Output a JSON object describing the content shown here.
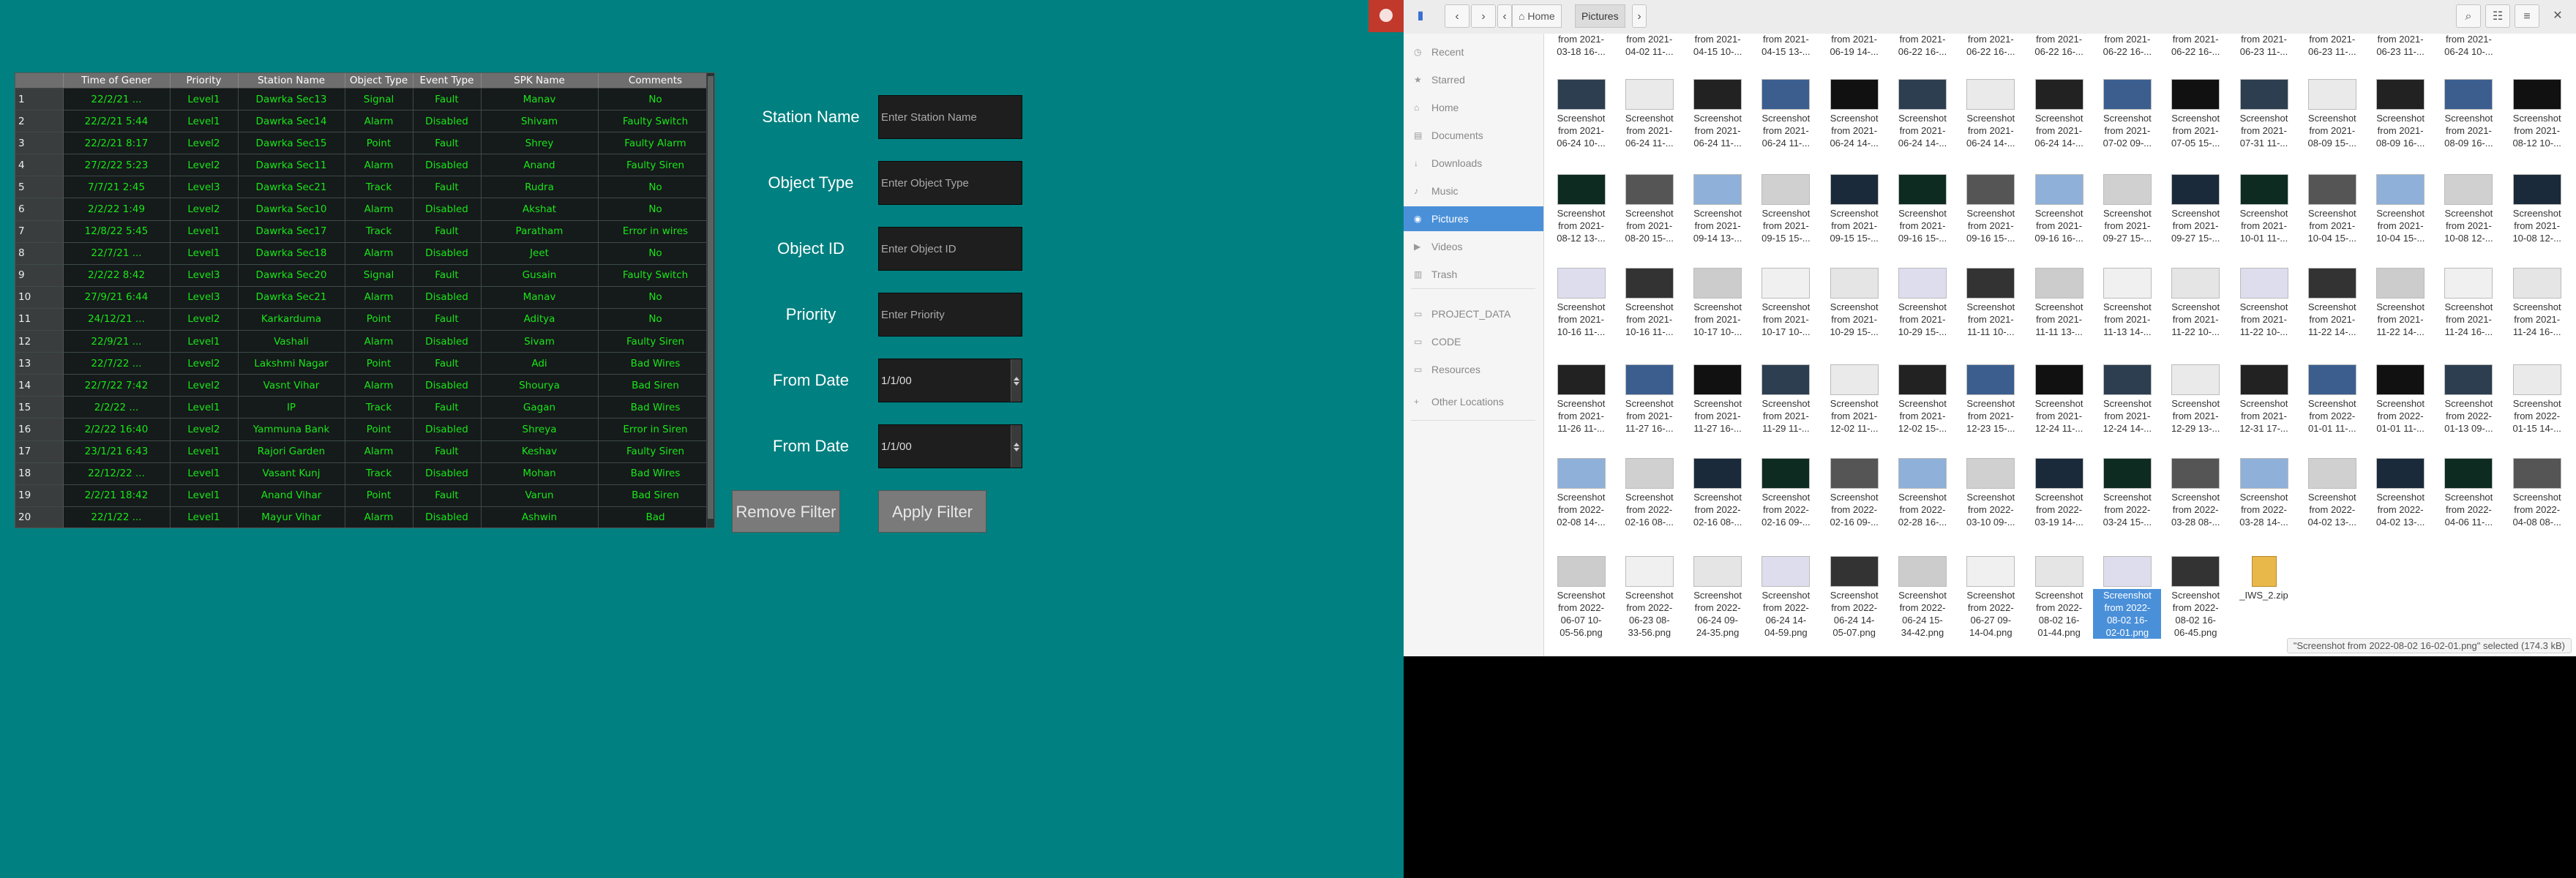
{
  "table": {
    "headers": [
      "Time of Gener",
      "Priority",
      "Station Name",
      "Object Type",
      "Event Type",
      "SPK Name",
      "Comments"
    ],
    "rows": [
      [
        "1",
        "22/2/21 ...",
        "Level1",
        "Dawrka Sec13",
        "Signal",
        "Fault",
        "Manav",
        "No"
      ],
      [
        "2",
        "22/2/21 5:44",
        "Level1",
        "Dawrka Sec14",
        "Alarm",
        "Disabled",
        "Shivam",
        "Faulty Switch"
      ],
      [
        "3",
        "22/2/21 8:17",
        "Level2",
        "Dawrka Sec15",
        "Point",
        "Fault",
        "Shrey",
        "Faulty Alarm"
      ],
      [
        "4",
        "27/2/22 5:23",
        "Level2",
        "Dawrka Sec11",
        "Alarm",
        "Disabled",
        "Anand",
        "Faulty Siren"
      ],
      [
        "5",
        "7/7/21 2:45",
        "Level3",
        "Dawrka Sec21",
        "Track",
        "Fault",
        "Rudra",
        "No"
      ],
      [
        "6",
        "2/2/22 1:49",
        "Level2",
        "Dawrka Sec10",
        "Alarm",
        "Disabled",
        "Akshat",
        "No"
      ],
      [
        "7",
        "12/8/22 5:45",
        "Level1",
        "Dawrka Sec17",
        "Track",
        "Fault",
        "Paratham",
        "Error in wires"
      ],
      [
        "8",
        "22/7/21 ...",
        "Level1",
        "Dawrka Sec18",
        "Alarm",
        "Disabled",
        "Jeet",
        "No"
      ],
      [
        "9",
        "2/2/22 8:42",
        "Level3",
        "Dawrka Sec20",
        "Signal",
        "Fault",
        "Gusain",
        "Faulty Switch"
      ],
      [
        "10",
        "27/9/21 6:44",
        "Level3",
        "Dawrka Sec21",
        "Alarm",
        "Disabled",
        "Manav",
        "No"
      ],
      [
        "11",
        "24/12/21 ...",
        "Level2",
        "Karkarduma",
        "Point",
        "Fault",
        "Aditya",
        "No"
      ],
      [
        "12",
        "22/9/21 ...",
        "Level1",
        "Vashali",
        "Alarm",
        "Disabled",
        "Sivam",
        "Faulty Siren"
      ],
      [
        "13",
        "22/7/22 ...",
        "Level2",
        "Lakshmi Nagar",
        "Point",
        "Fault",
        "Adi",
        "Bad Wires"
      ],
      [
        "14",
        "22/7/22 7:42",
        "Level2",
        "Vasnt Vihar",
        "Alarm",
        "Disabled",
        "Shourya",
        "Bad Siren"
      ],
      [
        "15",
        "2/2/22 ...",
        "Level1",
        "IP",
        "Track",
        "Fault",
        "Gagan",
        "Bad Wires"
      ],
      [
        "16",
        "2/2/22 16:40",
        "Level2",
        "Yammuna Bank",
        "Point",
        "Disabled",
        "Shreya",
        "Error in Siren"
      ],
      [
        "17",
        "23/1/21 6:43",
        "Level1",
        "Rajori Garden",
        "Alarm",
        "Fault",
        "Keshav",
        "Faulty Siren"
      ],
      [
        "18",
        "22/12/22 ...",
        "Level1",
        "Vasant Kunj",
        "Track",
        "Disabled",
        "Mohan",
        "Bad Wires"
      ],
      [
        "19",
        "2/2/21 18:42",
        "Level1",
        "Anand Vihar",
        "Point",
        "Fault",
        "Varun",
        "Bad Siren"
      ],
      [
        "20",
        "22/1/22 ...",
        "Level1",
        "Mayur Vihar",
        "Alarm",
        "Disabled",
        "Ashwin",
        "Bad"
      ]
    ]
  },
  "filters": {
    "station_name_label": "Station Name",
    "station_name_placeholder": "Enter Station Name",
    "object_type_label": "Object Type",
    "object_type_placeholder": "Enter Object Type",
    "object_id_label": "Object ID",
    "object_id_placeholder": "Enter Object ID",
    "priority_label": "Priority",
    "priority_placeholder": "Enter Priority",
    "from_date_label": "From Date",
    "from_date_value": "1/1/00",
    "from_date2_label": "From Date",
    "from_date2_value": "1/1/00",
    "remove_filter": "Remove Filter",
    "apply_filter": "Apply Filter"
  },
  "file_manager": {
    "path": [
      "Home",
      "Pictures"
    ],
    "sidebar": [
      "Recent",
      "Starred",
      "Home",
      "Documents",
      "Downloads",
      "Music",
      "Pictures",
      "Videos",
      "Trash",
      "PROJECT_DATA",
      "CODE",
      "Resources",
      "Other Locations"
    ],
    "sidebar_icons": [
      "clock-icon",
      "star-icon",
      "home-icon",
      "document-icon",
      "download-icon",
      "music-icon",
      "camera-icon",
      "video-icon",
      "trash-icon",
      "folder-icon",
      "folder-icon",
      "folder-icon",
      "plus-icon"
    ],
    "status": "\"Screenshot from 2022-08-02 16-02-01.png\" selected (174.3 kB)",
    "top_row": [
      "from 2021-\n03-18 16-...",
      "from 2021-\n04-02 11-...",
      "from 2021-\n04-15 10-...",
      "from 2021-\n04-15 13-...",
      "from 2021-\n06-19 14-...",
      "from 2021-\n06-22 16-...",
      "from 2021-\n06-22 16-...",
      "from 2021-\n06-22 16-...",
      "from 2021-\n06-22 16-...",
      "from 2021-\n06-22 16-...",
      "from 2021-\n06-23 11-...",
      "from 2021-\n06-23 11-...",
      "from 2021-\n06-23 11-...",
      "from 2021-\n06-24 10-..."
    ],
    "rows": [
      [
        "Screenshot\nfrom 2021-\n06-24 10-...",
        "Screenshot\nfrom 2021-\n06-24 11-...",
        "Screenshot\nfrom 2021-\n06-24 11-...",
        "Screenshot\nfrom 2021-\n06-24 11-...",
        "Screenshot\nfrom 2021-\n06-24 14-...",
        "Screenshot\nfrom 2021-\n06-24 14-...",
        "Screenshot\nfrom 2021-\n06-24 14-...",
        "Screenshot\nfrom 2021-\n06-24 14-...",
        "Screenshot\nfrom 2021-\n07-02 09-...",
        "Screenshot\nfrom 2021-\n07-05 15-...",
        "Screenshot\nfrom 2021-\n07-31 11-...",
        "Screenshot\nfrom 2021-\n08-09 15-...",
        "Screenshot\nfrom 2021-\n08-09 16-...",
        "Screenshot\nfrom 2021-\n08-09 16-...",
        "Screenshot\nfrom 2021-\n08-12 10-..."
      ],
      [
        "Screenshot\nfrom 2021-\n08-12 13-...",
        "Screenshot\nfrom 2021-\n08-20 15-...",
        "Screenshot\nfrom 2021-\n09-14 13-...",
        "Screenshot\nfrom 2021-\n09-15 15-...",
        "Screenshot\nfrom 2021-\n09-15 15-...",
        "Screenshot\nfrom 2021-\n09-16 15-...",
        "Screenshot\nfrom 2021-\n09-16 15-...",
        "Screenshot\nfrom 2021-\n09-16 16-...",
        "Screenshot\nfrom 2021-\n09-27 15-...",
        "Screenshot\nfrom 2021-\n09-27 15-...",
        "Screenshot\nfrom 2021-\n10-01 11-...",
        "Screenshot\nfrom 2021-\n10-04 15-...",
        "Screenshot\nfrom 2021-\n10-04 15-...",
        "Screenshot\nfrom 2021-\n10-08 12-...",
        "Screenshot\nfrom 2021-\n10-08 12-..."
      ],
      [
        "Screenshot\nfrom 2021-\n10-16 11-...",
        "Screenshot\nfrom 2021-\n10-16 11-...",
        "Screenshot\nfrom 2021-\n10-17 10-...",
        "Screenshot\nfrom 2021-\n10-17 10-...",
        "Screenshot\nfrom 2021-\n10-29 15-...",
        "Screenshot\nfrom 2021-\n10-29 15-...",
        "Screenshot\nfrom 2021-\n11-11 10-...",
        "Screenshot\nfrom 2021-\n11-11 13-...",
        "Screenshot\nfrom 2021-\n11-13 14-...",
        "Screenshot\nfrom 2021-\n11-22 10-...",
        "Screenshot\nfrom 2021-\n11-22 10-...",
        "Screenshot\nfrom 2021-\n11-22 14-...",
        "Screenshot\nfrom 2021-\n11-22 14-...",
        "Screenshot\nfrom 2021-\n11-24 16-...",
        "Screenshot\nfrom 2021-\n11-24 16-..."
      ],
      [
        "Screenshot\nfrom 2021-\n11-26 11-...",
        "Screenshot\nfrom 2021-\n11-27 16-...",
        "Screenshot\nfrom 2021-\n11-27 16-...",
        "Screenshot\nfrom 2021-\n11-29 11-...",
        "Screenshot\nfrom 2021-\n12-02 11-...",
        "Screenshot\nfrom 2021-\n12-02 15-...",
        "Screenshot\nfrom 2021-\n12-23 15-...",
        "Screenshot\nfrom 2021-\n12-24 11-...",
        "Screenshot\nfrom 2021-\n12-24 14-...",
        "Screenshot\nfrom 2021-\n12-29 13-...",
        "Screenshot\nfrom 2021-\n12-31 17-...",
        "Screenshot\nfrom 2022-\n01-01 11-...",
        "Screenshot\nfrom 2022-\n01-01 11-...",
        "Screenshot\nfrom 2022-\n01-13 09-...",
        "Screenshot\nfrom 2022-\n01-15 14-..."
      ],
      [
        "Screenshot\nfrom 2022-\n02-08 14-...",
        "Screenshot\nfrom 2022-\n02-16 08-...",
        "Screenshot\nfrom 2022-\n02-16 08-...",
        "Screenshot\nfrom 2022-\n02-16 09-...",
        "Screenshot\nfrom 2022-\n02-16 09-...",
        "Screenshot\nfrom 2022-\n02-28 16-...",
        "Screenshot\nfrom 2022-\n03-10 09-...",
        "Screenshot\nfrom 2022-\n03-19 14-...",
        "Screenshot\nfrom 2022-\n03-24 15-...",
        "Screenshot\nfrom 2022-\n03-28 08-...",
        "Screenshot\nfrom 2022-\n03-28 14-...",
        "Screenshot\nfrom 2022-\n04-02 13-...",
        "Screenshot\nfrom 2022-\n04-02 13-...",
        "Screenshot\nfrom 2022-\n04-06 11-...",
        "Screenshot\nfrom 2022-\n04-08 08-..."
      ],
      [
        "Screenshot\nfrom 2022-\n06-07 10-\n05-56.png",
        "Screenshot\nfrom 2022-\n06-23 08-\n33-56.png",
        "Screenshot\nfrom 2022-\n06-24 09-\n24-35.png",
        "Screenshot\nfrom 2022-\n06-24 14-\n04-59.png",
        "Screenshot\nfrom 2022-\n06-24 14-\n05-07.png",
        "Screenshot\nfrom 2022-\n06-24 15-\n34-42.png",
        "Screenshot\nfrom 2022-\n06-27 09-\n14-04.png",
        "Screenshot\nfrom 2022-\n08-02 16-\n01-44.png",
        "Screenshot\nfrom 2022-\n08-02 16-\n02-01.png",
        "Screenshot\nfrom 2022-\n08-02 16-\n06-45.png",
        "_IWS_2.zip"
      ]
    ],
    "selected_name": "Screenshot\nfrom 2022-\n08-02 16-\n02-01.png"
  }
}
